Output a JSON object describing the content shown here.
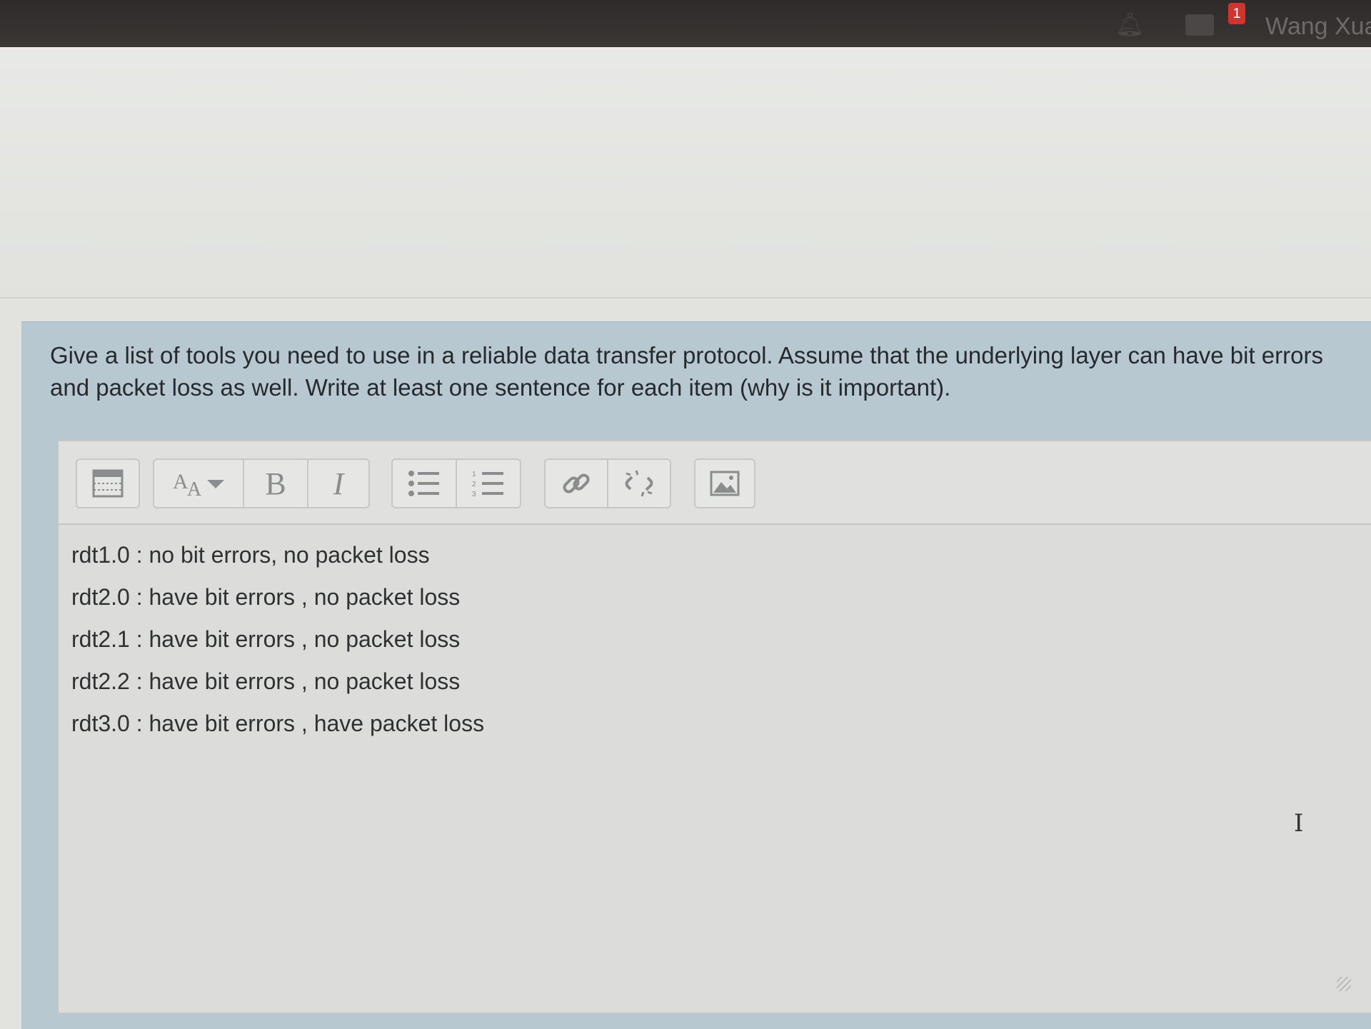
{
  "topbar": {
    "notification_count": "1",
    "user_name": "Wang Xua"
  },
  "question": {
    "text": "Give a list of tools you need to use in a reliable data transfer protocol. Assume that the underlying layer can have bit errors and packet loss as well. Write at least one sentence for each item (why is it important)."
  },
  "toolbar": {
    "icons": [
      "table-icon",
      "font-size-icon",
      "bold-icon",
      "italic-icon",
      "bullet-list-icon",
      "numbered-list-icon",
      "link-icon",
      "unlink-icon",
      "image-icon"
    ],
    "bold_label": "B",
    "italic_label": "I"
  },
  "answer": {
    "lines": [
      "rdt1.0 : no bit errors, no packet loss",
      "rdt2.0 : have bit errors , no packet loss",
      "rdt2.1 : have bit errors , no packet loss",
      "rdt2.2 : have bit errors , no packet loss",
      "rdt3.0 : have bit errors , have packet loss"
    ]
  }
}
